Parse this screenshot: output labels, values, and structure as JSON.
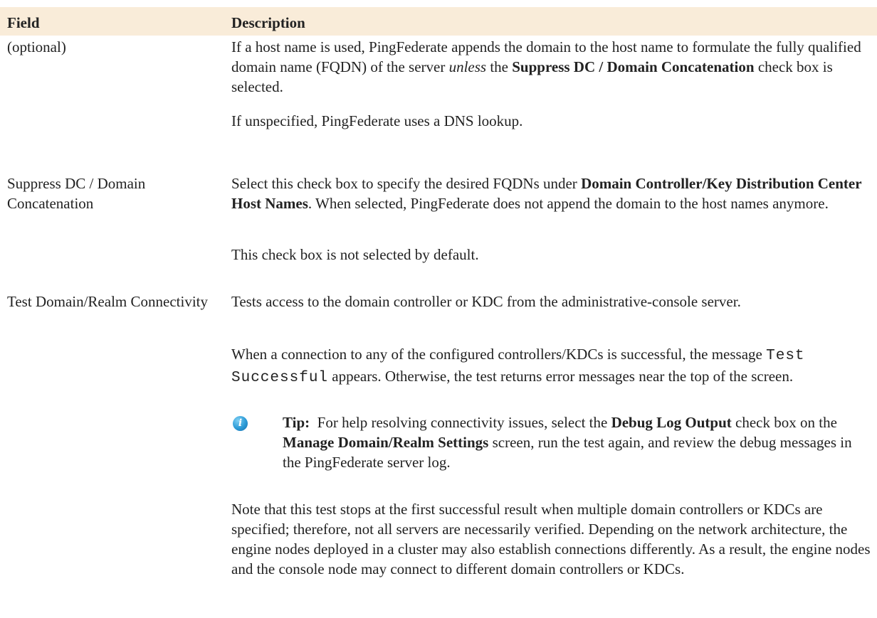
{
  "header": {
    "field": "Field",
    "description": "Description"
  },
  "rows": [
    {
      "field": "(optional)",
      "paragraphs": [
        {
          "p1_pre": "If a host name is used, PingFederate appends the domain to the host name to formulate the fully qualified domain name (FQDN) of the server ",
          "p1_em": "unless",
          "p1_mid": " the ",
          "p1_strong": "Suppress DC / Domain Concatenation",
          "p1_post": " check box is selected."
        },
        {
          "text": "If unspecified, PingFederate uses a DNS lookup."
        }
      ]
    },
    {
      "field": "Suppress DC / Domain Concatenation",
      "paragraphs": [
        {
          "pre": "Select this check box to specify the desired FQDNs under ",
          "strong": "Domain Controller/Key Distribution Center Host Names",
          "post": ". When selected, PingFederate does not append the domain to the host names anymore."
        },
        {
          "text": "This check box is not selected by default."
        }
      ]
    },
    {
      "field": "Test Domain/Realm Connectivity",
      "paragraphs": [
        {
          "text": "Tests access to the domain controller or KDC from the administrative-console server."
        },
        {
          "pre": "When a connection to any of the configured controllers/KDCs is successful, the message ",
          "code": "Test Successful",
          "post": " appears. Otherwise, the test returns error messages near the top of the screen."
        },
        {
          "text": "Note that this test stops at the first successful result when multiple domain controllers or KDCs are specified; therefore, not all servers are necessarily verified. Depending on the network architecture, the engine nodes deployed in a cluster may also establish connections differently. As a result, the engine nodes and the console node may connect to different domain controllers or KDCs."
        }
      ],
      "tip": {
        "label": "Tip:",
        "pre": "  For help resolving connectivity issues, select the ",
        "strong1": "Debug Log Output",
        "mid1": " check box on the ",
        "strong2": "Manage Domain/Realm Settings",
        "post": " screen, run the test again, and review the debug messages in the PingFederate server log.",
        "icon": "info-icon",
        "icon_glyph": "i"
      }
    }
  ],
  "colors": {
    "header_bg": "#f9ecd9",
    "text": "#222222",
    "info_icon": "#2b9ad6"
  }
}
